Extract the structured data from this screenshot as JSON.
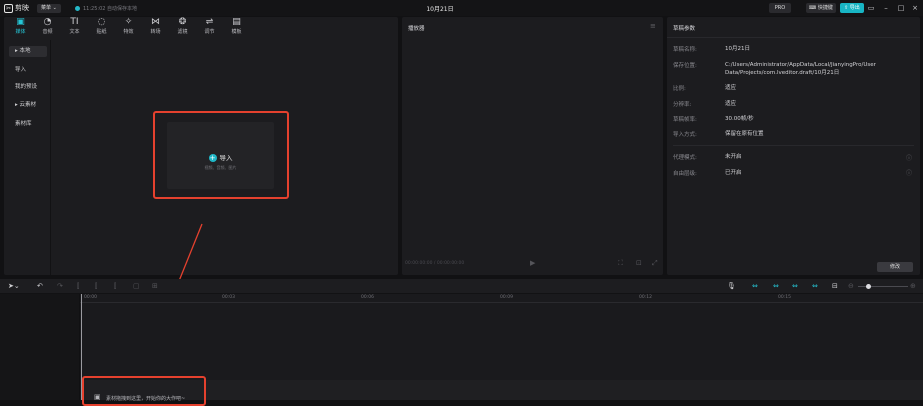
{
  "titlebar": {
    "app_name": "剪映",
    "menu_label": "菜单",
    "save_status": "11:25:02 自动保存本地",
    "project_title": "10月21日",
    "pro_label": "PRO",
    "shortcut_label": "快捷键",
    "export_label": "导出"
  },
  "toolbar": {
    "items": [
      {
        "label": "媒体",
        "icon": "media-icon"
      },
      {
        "label": "音频",
        "icon": "audio-icon"
      },
      {
        "label": "文本",
        "icon": "text-icon"
      },
      {
        "label": "贴纸",
        "icon": "sticker-icon"
      },
      {
        "label": "特效",
        "icon": "effects-icon"
      },
      {
        "label": "转场",
        "icon": "transition-icon"
      },
      {
        "label": "滤镜",
        "icon": "filter-icon"
      },
      {
        "label": "调节",
        "icon": "adjust-icon"
      },
      {
        "label": "模板",
        "icon": "template-icon"
      }
    ]
  },
  "sidenav": {
    "items": [
      "本地",
      "导入",
      "我的预设",
      "云素材",
      "素材库"
    ]
  },
  "import": {
    "label": "导入",
    "hint": "视频、音频、图片"
  },
  "player": {
    "title": "播放器",
    "time": "00:00:00:00 / 00:00:00:00"
  },
  "properties": {
    "title": "草稿参数",
    "rows": [
      {
        "key": "草稿名称:",
        "value": "10月21日"
      },
      {
        "key": "保存位置:",
        "value": "C:/Users/Administrator/AppData/Local/JianyingPro/User Data/Projects/com.lveditor.draft/10月21日"
      },
      {
        "key": "比例:",
        "value": "适应"
      },
      {
        "key": "分辨率:",
        "value": "适应"
      },
      {
        "key": "草稿帧率:",
        "value": "30.00帧/秒"
      },
      {
        "key": "导入方式:",
        "value": "保留在原有位置"
      },
      {
        "key": "代理模式:",
        "value": "未开启"
      },
      {
        "key": "自由层级:",
        "value": "已开启"
      }
    ],
    "modify_label": "修改"
  },
  "timeline": {
    "ticks": [
      "00:00",
      "00:03",
      "00:06",
      "00:09",
      "00:12",
      "00:15"
    ],
    "drop_hint": "素材拖拽到这里，开始你的大作吧~"
  },
  "colors": {
    "accent": "#1fb7c7",
    "highlight": "#e5412e"
  }
}
